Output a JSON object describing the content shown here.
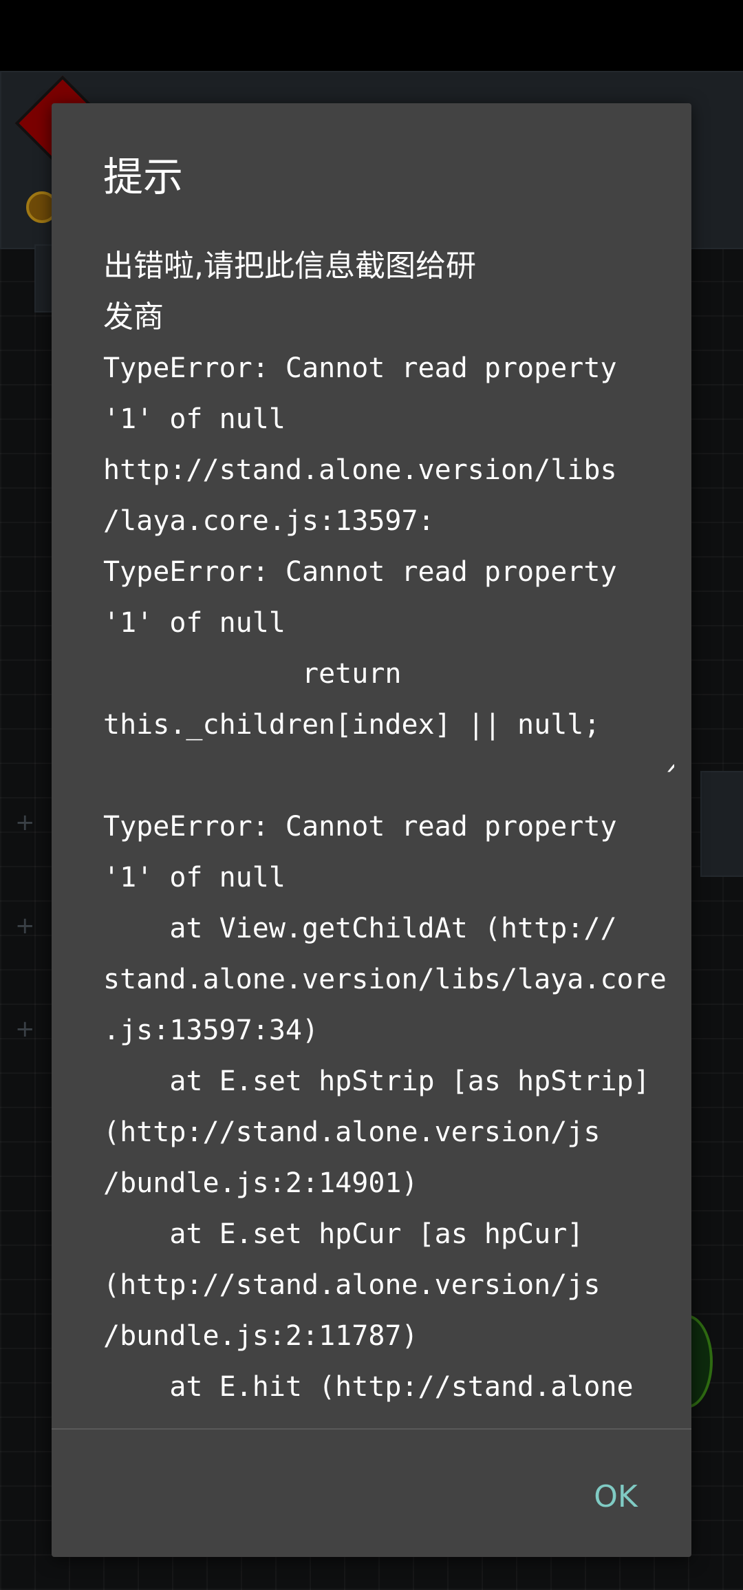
{
  "dialog": {
    "title": "提示",
    "message_lines": [
      "出错啦,请把此信息截图给研",
      "发商",
      "TypeError: Cannot read property",
      "'1' of null",
      "http://stand.alone.version/libs",
      "/laya.core.js:13597:",
      "TypeError: Cannot read property",
      "'1' of null",
      "            return",
      "this._children[index] || null;",
      "                                  ^^",
      "TypeError: Cannot read property",
      "'1' of null",
      "    at View.getChildAt (http://",
      "stand.alone.version/libs/laya.core",
      ".js:13597:34)",
      "    at E.set hpStrip [as hpStrip]",
      "(http://stand.alone.version/js",
      "/bundle.js:2:14901)",
      "    at E.set hpCur [as hpCur]",
      "(http://stand.alone.version/js",
      "/bundle.js:2:11787)",
      "    at E.hit (http://stand.alone"
    ],
    "ok_label": "OK"
  },
  "colors": {
    "dialog_background": "#434343",
    "text": "#ffffff",
    "accent": "#80cbc4",
    "overlay_background": "#0e0f10"
  }
}
